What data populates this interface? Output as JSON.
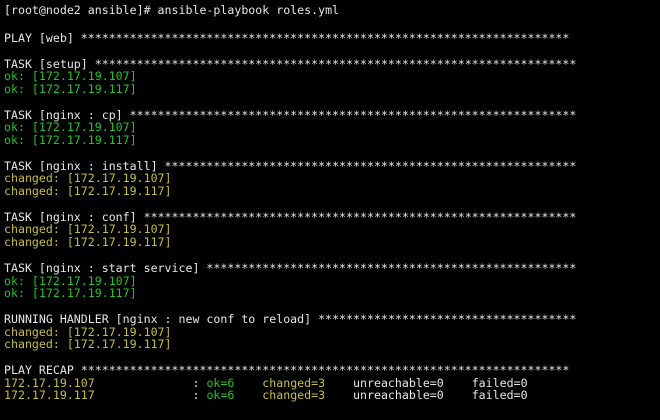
{
  "colors": {
    "background": "#000000",
    "text": "#e6e6e6",
    "ok": "#26c326",
    "changed": "#c8be3c"
  },
  "prompt": {
    "text": "[root@node2 ansible]# ansible-playbook roles.yml"
  },
  "play": {
    "header": "PLAY [web] ",
    "stars": "**********************************************************************"
  },
  "tasks": [
    {
      "header": "TASK [setup] ",
      "stars": "*********************************************************************",
      "results": [
        {
          "status": "ok",
          "text": "ok: [172.17.19.107]"
        },
        {
          "status": "ok",
          "text": "ok: [172.17.19.117]"
        }
      ]
    },
    {
      "header": "TASK [nginx : cp] ",
      "stars": "****************************************************************",
      "results": [
        {
          "status": "ok",
          "text": "ok: [172.17.19.107]"
        },
        {
          "status": "ok",
          "text": "ok: [172.17.19.117]"
        }
      ]
    },
    {
      "header": "TASK [nginx : install] ",
      "stars": "***********************************************************",
      "results": [
        {
          "status": "changed",
          "text": "changed: [172.17.19.107]"
        },
        {
          "status": "changed",
          "text": "changed: [172.17.19.117]"
        }
      ]
    },
    {
      "header": "TASK [nginx : conf] ",
      "stars": "**************************************************************",
      "results": [
        {
          "status": "changed",
          "text": "changed: [172.17.19.107]"
        },
        {
          "status": "changed",
          "text": "changed: [172.17.19.117]"
        }
      ]
    },
    {
      "header": "TASK [nginx : start service] ",
      "stars": "*****************************************************",
      "results": [
        {
          "status": "ok",
          "text": "ok: [172.17.19.107]"
        },
        {
          "status": "ok",
          "text": "ok: [172.17.19.117]"
        }
      ]
    },
    {
      "header": "RUNNING HANDLER [nginx : new conf to reload] ",
      "stars": "*************************************",
      "results": [
        {
          "status": "changed",
          "text": "changed: [172.17.19.107]"
        },
        {
          "status": "changed",
          "text": "changed: [172.17.19.117]"
        }
      ]
    }
  ],
  "recap": {
    "header": "PLAY RECAP ",
    "stars": "**********************************************************************",
    "rows": [
      {
        "host": "172.17.19.107",
        "ok": "ok=6",
        "changed": "changed=3",
        "unreachable": "unreachable=0",
        "failed": "failed=0"
      },
      {
        "host": "172.17.19.117",
        "ok": "ok=6",
        "changed": "changed=3",
        "unreachable": "unreachable=0",
        "failed": "failed=0"
      }
    ]
  }
}
